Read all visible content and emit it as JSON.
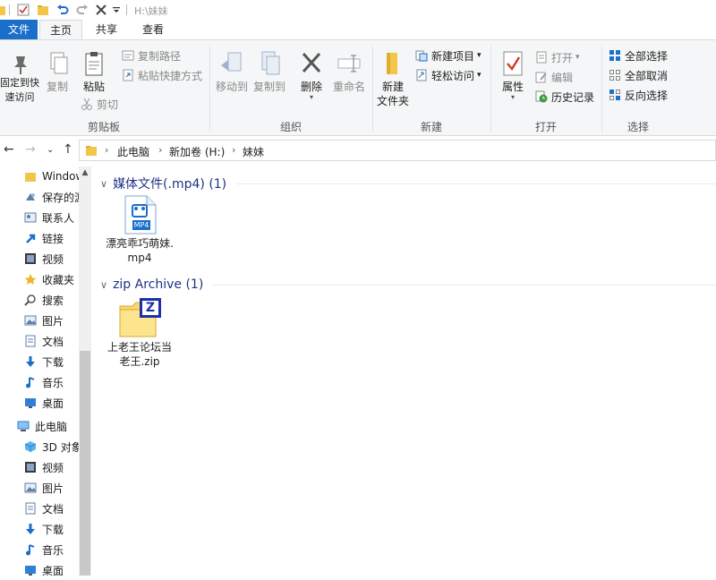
{
  "window": {
    "title": "H:\\妹妹"
  },
  "tabs": [
    {
      "label": "文件"
    },
    {
      "label": "主页"
    },
    {
      "label": "共享"
    },
    {
      "label": "查看"
    }
  ],
  "ribbon": {
    "clipboard": {
      "pin": "固定到快\n速访问",
      "copy": "复制",
      "paste": "粘贴",
      "copy_path": "复制路径",
      "paste_shortcut": "粘贴快捷方式",
      "cut": "剪切",
      "label": "剪贴板"
    },
    "organize": {
      "move_to": "移动到",
      "copy_to": "复制到",
      "delete": "删除",
      "rename": "重命名",
      "label": "组织"
    },
    "new": {
      "new_folder": "新建\n文件夹",
      "new_item": "新建项目",
      "easy_access": "轻松访问",
      "label": "新建"
    },
    "open": {
      "properties": "属性",
      "open": "打开",
      "edit": "编辑",
      "history": "历史记录",
      "label": "打开"
    },
    "select": {
      "select_all": "全部选择",
      "select_none": "全部取消",
      "invert": "反向选择",
      "label": "选择"
    }
  },
  "address": {
    "crumbs": [
      "此电脑",
      "新加卷 (H:)",
      "妹妹"
    ]
  },
  "nav": {
    "items": [
      {
        "label": "Windows",
        "icon": "folder-icon"
      },
      {
        "label": "保存的游戏",
        "icon": "saved-games-icon"
      },
      {
        "label": "联系人",
        "icon": "contacts-icon"
      },
      {
        "label": "链接",
        "icon": "links-icon"
      },
      {
        "label": "视频",
        "icon": "video-icon"
      },
      {
        "label": "收藏夹",
        "icon": "favorites-icon"
      },
      {
        "label": "搜索",
        "icon": "search-icon"
      },
      {
        "label": "图片",
        "icon": "pictures-icon"
      },
      {
        "label": "文档",
        "icon": "documents-icon"
      },
      {
        "label": "下载",
        "icon": "download-icon"
      },
      {
        "label": "音乐",
        "icon": "music-icon"
      },
      {
        "label": "桌面",
        "icon": "desktop-icon"
      },
      {
        "label": "此电脑",
        "icon": "this-pc-icon"
      },
      {
        "label": "3D 对象",
        "icon": "3d-objects-icon"
      },
      {
        "label": "视频",
        "icon": "video-icon"
      },
      {
        "label": "图片",
        "icon": "pictures-icon"
      },
      {
        "label": "文档",
        "icon": "documents-icon"
      },
      {
        "label": "下载",
        "icon": "download-icon"
      },
      {
        "label": "音乐",
        "icon": "music-icon"
      },
      {
        "label": "桌面",
        "icon": "desktop-icon"
      }
    ]
  },
  "content": {
    "groups": [
      {
        "header": "媒体文件(.mp4) (1)",
        "files": [
          {
            "name": "漂亮乖巧萌妹.mp4",
            "badge": "MP4"
          }
        ]
      },
      {
        "header": "zip Archive (1)",
        "files": [
          {
            "name": "上老王论坛当老王.zip",
            "badge": "Z"
          }
        ]
      }
    ]
  },
  "colors": {
    "accent": "#1a6fc9",
    "group_header": "#1e3287",
    "ribbon_bg": "#f5f6f7"
  }
}
